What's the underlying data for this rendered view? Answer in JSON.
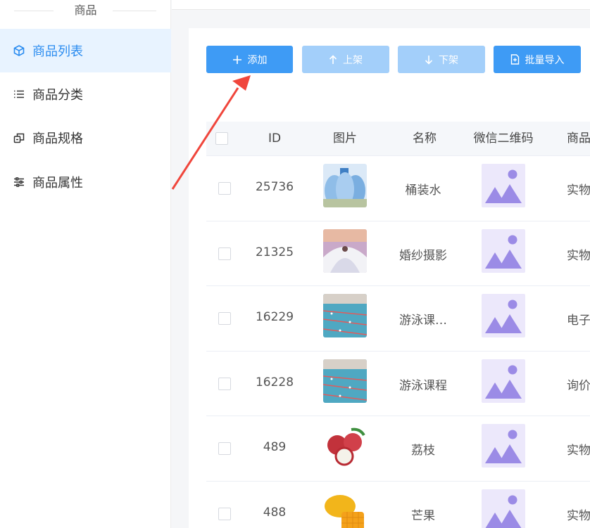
{
  "sidebar": {
    "title": "商品",
    "items": [
      {
        "label": "商品列表",
        "icon": "cube-icon",
        "active": true
      },
      {
        "label": "商品分类",
        "icon": "list-icon",
        "active": false
      },
      {
        "label": "商品规格",
        "icon": "spec-icon",
        "active": false
      },
      {
        "label": "商品属性",
        "icon": "sliders-icon",
        "active": false
      }
    ]
  },
  "toolbar": {
    "add_label": "添加",
    "on_shelf_label": "上架",
    "off_shelf_label": "下架",
    "import_label": "批量导入"
  },
  "table": {
    "headers": [
      "ID",
      "图片",
      "名称",
      "微信二维码",
      "商品"
    ],
    "rows": [
      {
        "id": "25736",
        "name": "桶装水",
        "type": "实物",
        "image": "water-bottle-photo"
      },
      {
        "id": "21325",
        "name": "婚纱摄影",
        "type": "实物",
        "image": "wedding-photo"
      },
      {
        "id": "16229",
        "name": "游泳课…",
        "type": "电子",
        "image": "swimming-pool-photo"
      },
      {
        "id": "16228",
        "name": "游泳课程",
        "type": "询价",
        "image": "swimming-pool-photo"
      },
      {
        "id": "489",
        "name": "荔枝",
        "type": "实物",
        "image": "lychee-photo"
      },
      {
        "id": "488",
        "name": "芒果",
        "type": "实物",
        "image": "mango-photo"
      }
    ]
  },
  "colors": {
    "primary": "#3e9bf5",
    "disabled": "#a3cffa",
    "active_nav_bg": "#e8f3ff",
    "active_nav_text": "#2b8cf0",
    "placeholder_bg": "#ece8fb",
    "placeholder_fg": "#9b8be6",
    "annotation_arrow": "#f0463c"
  }
}
